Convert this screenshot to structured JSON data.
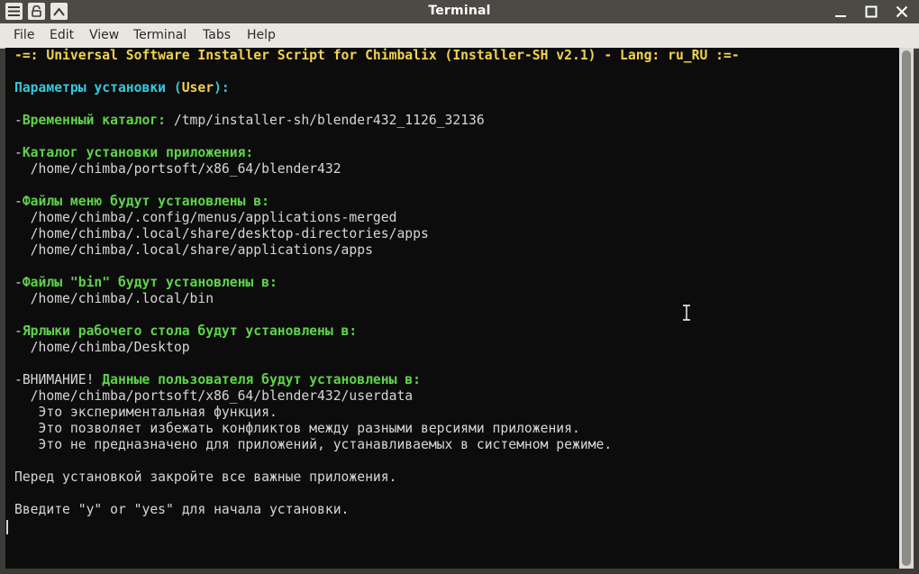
{
  "window": {
    "title": "Terminal",
    "icons": [
      "menu-icon",
      "lock-icon",
      "pin-icon",
      "minimize-icon",
      "maximize-icon",
      "close-icon"
    ]
  },
  "menubar": {
    "items": [
      "File",
      "Edit",
      "View",
      "Terminal",
      "Tabs",
      "Help"
    ]
  },
  "terminal": {
    "header": "-=: Universal Software Installer Script for Chimbalix (Installer-SH v2.1) - Lang: ru_RU :=-",
    "params_label": "Параметры установки (",
    "params_user": "User",
    "params_end": "):",
    "dash": "-",
    "temp_label": "Временный каталог:",
    "temp_path": " /tmp/installer-sh/blender432_1126_32136",
    "app_dir_label": "Каталог установки приложения:",
    "app_dir_path": "  /home/chimba/portsoft/x86_64/blender432",
    "menu_label": "Файлы меню будут установлены в:",
    "menu_path1": "  /home/chimba/.config/menus/applications-merged",
    "menu_path2": "  /home/chimba/.local/share/desktop-directories/apps",
    "menu_path3": "  /home/chimba/.local/share/applications/apps",
    "bin_label": "Файлы \"bin\" будут установлены в:",
    "bin_path": "  /home/chimba/.local/bin",
    "desktop_label": "Ярлыки рабочего стола будут установлены в:",
    "desktop_path": "  /home/chimba/Desktop",
    "warn_prefix": "-ВНИМАНИЕ! ",
    "warn_label": "Данные пользователя будут установлены в:",
    "userdata_path": "  /home/chimba/portsoft/x86_64/blender432/userdata",
    "note1": "   Это экспериментальная функция.",
    "note2": "   Это позволяет избежать конфликтов между разными версиями приложения.",
    "note3": "   Это не предназначено для приложений, устанавливаемых в системном режиме.",
    "close_apps": "Перед установкой закройте все важные приложения.",
    "prompt": "Введите \"y\" or \"yes\" для начала установки."
  }
}
